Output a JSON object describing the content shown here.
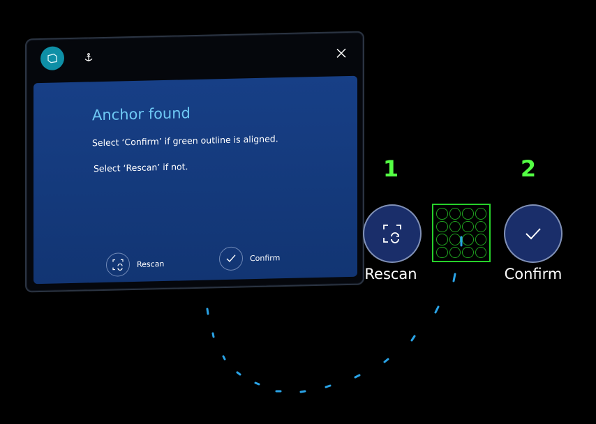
{
  "panel": {
    "title": "Anchor found",
    "instruction_confirm": "Select ‘Confirm’ if green outline is aligned.",
    "instruction_rescan": "Select ‘Rescan’ if not.",
    "rescan_label": "Rescan",
    "confirm_label": "Confirm"
  },
  "controls": {
    "step1": "1",
    "step2": "2",
    "rescan_label": "Rescan",
    "confirm_label": "Confirm"
  },
  "colors": {
    "accent_cyan": "#0e8fa6",
    "title_blue": "#6ec9f4",
    "panel_blue": "#173f86",
    "highlight_green": "#54ff44",
    "progress_tick": "#2aa3e6"
  },
  "icons": [
    "panel-tab-icon",
    "anchor-icon",
    "close-icon",
    "rescan-icon",
    "checkmark-icon",
    "marker-grid-icon"
  ]
}
